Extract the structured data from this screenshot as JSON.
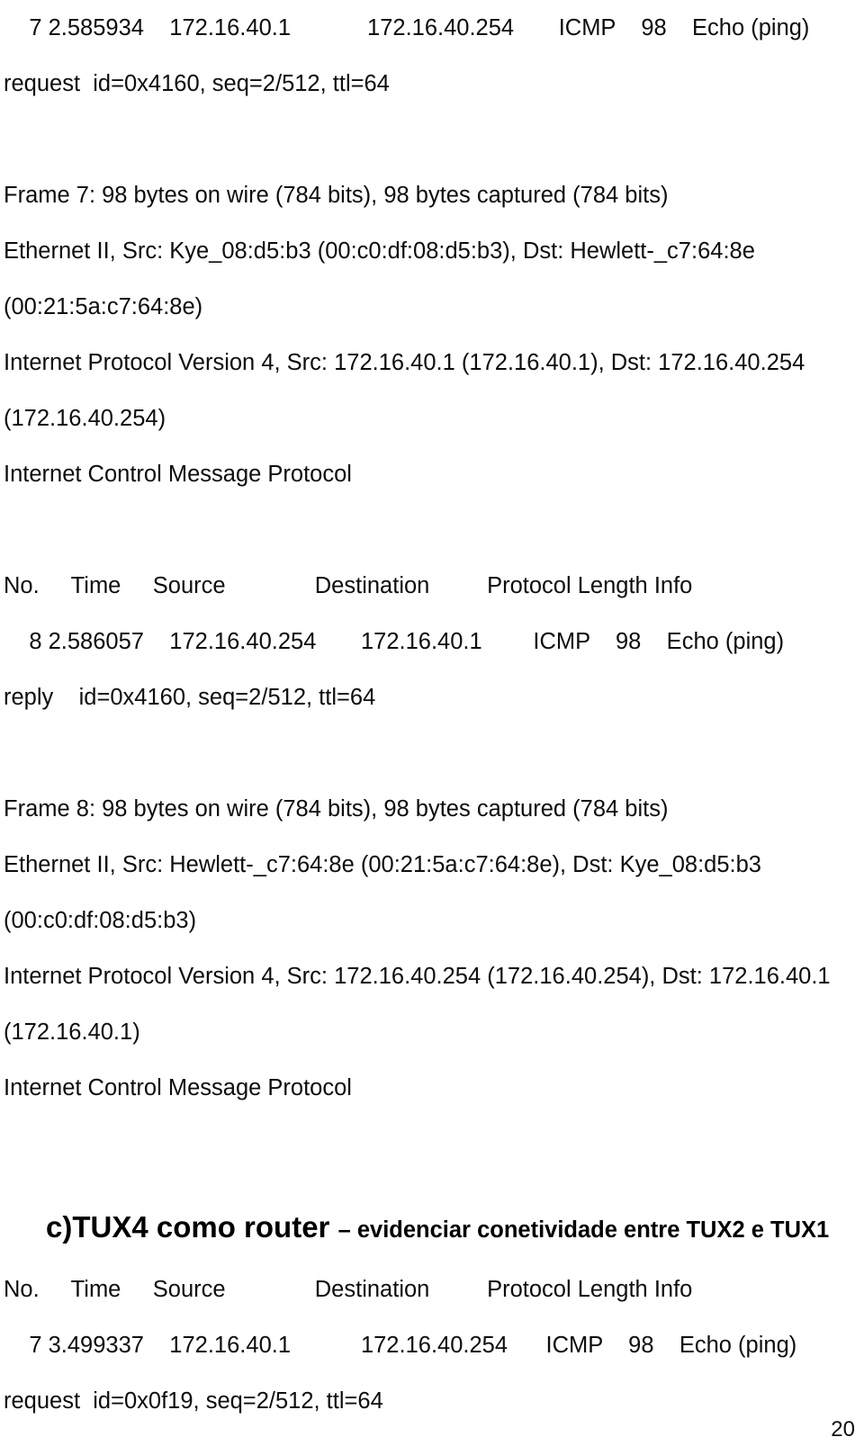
{
  "document": {
    "page_number": "20",
    "packet_list_columns": "No.     Time     Source              Destination         Protocol Length Info",
    "sections": {
      "frame7_capture": {
        "row_line1": "    7 2.585934    172.16.40.1            172.16.40.254       ICMP    98    Echo (ping)",
        "row_line2": "request  id=0x4160, seq=2/512, ttl=64",
        "frame_line": "Frame 7: 98 bytes on wire (784 bits), 98 bytes captured (784 bits)",
        "ethernet_line1": "Ethernet II, Src: Kye_08:d5:b3 (00:c0:df:08:d5:b3), Dst: Hewlett-_c7:64:8e",
        "ethernet_line2": "(00:21:5a:c7:64:8e)",
        "ip_line1": "Internet Protocol Version 4, Src: 172.16.40.1 (172.16.40.1), Dst: 172.16.40.254",
        "ip_line2": "(172.16.40.254)",
        "icmp_line": "Internet Control Message Protocol"
      },
      "frame8_capture": {
        "row_line1": "    8 2.586057    172.16.40.254       172.16.40.1        ICMP    98    Echo (ping)",
        "row_line2": "reply    id=0x4160, seq=2/512, ttl=64",
        "frame_line": "Frame 8: 98 bytes on wire (784 bits), 98 bytes captured (784 bits)",
        "ethernet_line1": "Ethernet II, Src: Hewlett-_c7:64:8e (00:21:5a:c7:64:8e), Dst: Kye_08:d5:b3",
        "ethernet_line2": "(00:c0:df:08:d5:b3)",
        "ip_line1": "Internet Protocol Version 4, Src: 172.16.40.254 (172.16.40.254), Dst: 172.16.40.1",
        "ip_line2": "(172.16.40.1)",
        "icmp_line": "Internet Control Message Protocol"
      },
      "section_c": {
        "heading_main": "c)TUX4 como router ",
        "heading_sub": "– evidenciar conetividade entre TUX2 e TUX1",
        "row_line1": "    7 3.499337    172.16.40.1           172.16.40.254      ICMP    98    Echo (ping)",
        "row_line2": "request  id=0x0f19, seq=2/512, ttl=64"
      }
    }
  }
}
